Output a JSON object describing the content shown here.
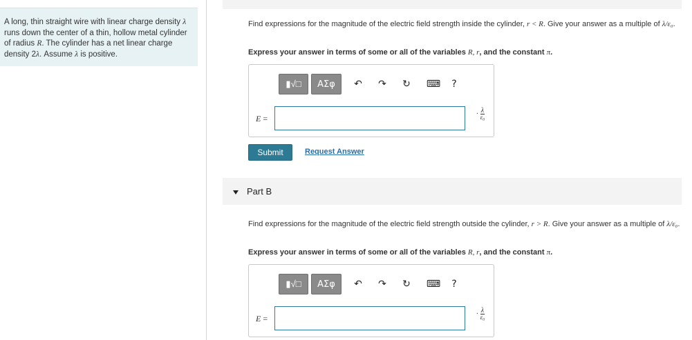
{
  "problem": {
    "text_html": "A long, thin straight wire with linear charge density <span class=\"italic\">λ</span> runs down the center of a thin, hollow metal cylinder of radius <span class=\"italic\">R</span>. The cylinder has a net linear charge density 2<span class=\"italic\">λ</span>. Assume <span class=\"italic\">λ</span> is positive."
  },
  "partA": {
    "question_prefix": "Find expressions for the magnitude of the electric field strength inside the cylinder, ",
    "question_cond": "r < R",
    "question_suffix": ". Give your answer as a multiple of ",
    "question_mult": "λ/ε₀",
    "question_end": ".",
    "instruction_prefix": "Express your answer in terms of some or all of the variables ",
    "instruction_vars": "R, r",
    "instruction_suffix": ", and the constant ",
    "instruction_const": "π",
    "instruction_end": ".",
    "field_label": "E",
    "field_eq": " =",
    "field_value": "",
    "unit_prefix": "·",
    "unit_num": "λ",
    "unit_den": "ε₀",
    "submit_label": "Submit",
    "request_label": "Request Answer"
  },
  "partB": {
    "header": "Part B",
    "question_prefix": "Find expressions for the magnitude of the electric field strength outside the cylinder, ",
    "question_cond": "r > R",
    "question_suffix": ". Give your answer as a multiple of ",
    "question_mult": "λ/ε₀",
    "question_end": ".",
    "instruction_prefix": "Express your answer in terms of some or all of the variables ",
    "instruction_vars": "R, r",
    "instruction_suffix": ", and the constant ",
    "instruction_const": "π",
    "instruction_end": ".",
    "field_label": "E",
    "field_eq": " =",
    "field_value": "",
    "unit_prefix": "·",
    "unit_num": "λ",
    "unit_den": "ε₀"
  },
  "toolbar": {
    "sqrt_label": "▮√□",
    "greek_label": "ΑΣφ",
    "undo_icon": "↶",
    "redo_icon": "↷",
    "reset_icon": "↻",
    "keyboard_icon": "⌨",
    "help_label": "?"
  },
  "colors": {
    "panel_bg": "#e7f2f5",
    "submit_bg": "#2d7a95",
    "input_border": "#2a7d9c",
    "link": "#2a6fa8"
  }
}
